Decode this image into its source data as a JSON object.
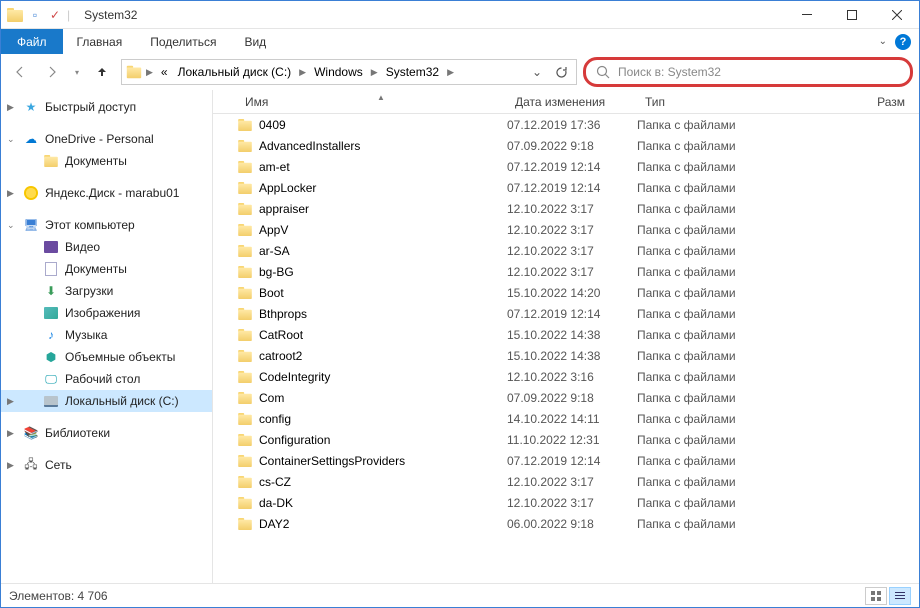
{
  "window": {
    "title": "System32"
  },
  "ribbon": {
    "file": "Файл",
    "tabs": [
      "Главная",
      "Поделиться",
      "Вид"
    ]
  },
  "breadcrumb": {
    "items": [
      "Локальный диск (C:)",
      "Windows",
      "System32"
    ],
    "prefix": "«"
  },
  "search": {
    "placeholder": "Поиск в: System32"
  },
  "columns": {
    "name": "Имя",
    "date": "Дата изменения",
    "type": "Тип",
    "size": "Разм"
  },
  "nav": {
    "quick": "Быстрый доступ",
    "onedrive": "OneDrive - Personal",
    "onedrive_docs": "Документы",
    "yadisk": "Яндекс.Диск - marabu01",
    "thispc": "Этот компьютер",
    "video": "Видео",
    "docs": "Документы",
    "downloads": "Загрузки",
    "pictures": "Изображения",
    "music": "Музыка",
    "objects3d": "Объемные объекты",
    "desktop": "Рабочий стол",
    "cdrive": "Локальный диск (C:)",
    "libraries": "Библиотеки",
    "network": "Сеть"
  },
  "files": [
    {
      "name": "0409",
      "date": "07.12.2019 17:36",
      "type": "Папка с файлами"
    },
    {
      "name": "AdvancedInstallers",
      "date": "07.09.2022 9:18",
      "type": "Папка с файлами"
    },
    {
      "name": "am-et",
      "date": "07.12.2019 12:14",
      "type": "Папка с файлами"
    },
    {
      "name": "AppLocker",
      "date": "07.12.2019 12:14",
      "type": "Папка с файлами"
    },
    {
      "name": "appraiser",
      "date": "12.10.2022 3:17",
      "type": "Папка с файлами"
    },
    {
      "name": "AppV",
      "date": "12.10.2022 3:17",
      "type": "Папка с файлами"
    },
    {
      "name": "ar-SA",
      "date": "12.10.2022 3:17",
      "type": "Папка с файлами"
    },
    {
      "name": "bg-BG",
      "date": "12.10.2022 3:17",
      "type": "Папка с файлами"
    },
    {
      "name": "Boot",
      "date": "15.10.2022 14:20",
      "type": "Папка с файлами"
    },
    {
      "name": "Bthprops",
      "date": "07.12.2019 12:14",
      "type": "Папка с файлами"
    },
    {
      "name": "CatRoot",
      "date": "15.10.2022 14:38",
      "type": "Папка с файлами"
    },
    {
      "name": "catroot2",
      "date": "15.10.2022 14:38",
      "type": "Папка с файлами"
    },
    {
      "name": "CodeIntegrity",
      "date": "12.10.2022 3:16",
      "type": "Папка с файлами"
    },
    {
      "name": "Com",
      "date": "07.09.2022 9:18",
      "type": "Папка с файлами"
    },
    {
      "name": "config",
      "date": "14.10.2022 14:11",
      "type": "Папка с файлами"
    },
    {
      "name": "Configuration",
      "date": "11.10.2022 12:31",
      "type": "Папка с файлами"
    },
    {
      "name": "ContainerSettingsProviders",
      "date": "07.12.2019 12:14",
      "type": "Папка с файлами"
    },
    {
      "name": "cs-CZ",
      "date": "12.10.2022 3:17",
      "type": "Папка с файлами"
    },
    {
      "name": "da-DK",
      "date": "12.10.2022 3:17",
      "type": "Папка с файлами"
    },
    {
      "name": "DAY2",
      "date": "06.00.2022 9:18",
      "type": "Папка с файлами"
    }
  ],
  "status": {
    "count_label": "Элементов:",
    "count": "4 706"
  }
}
